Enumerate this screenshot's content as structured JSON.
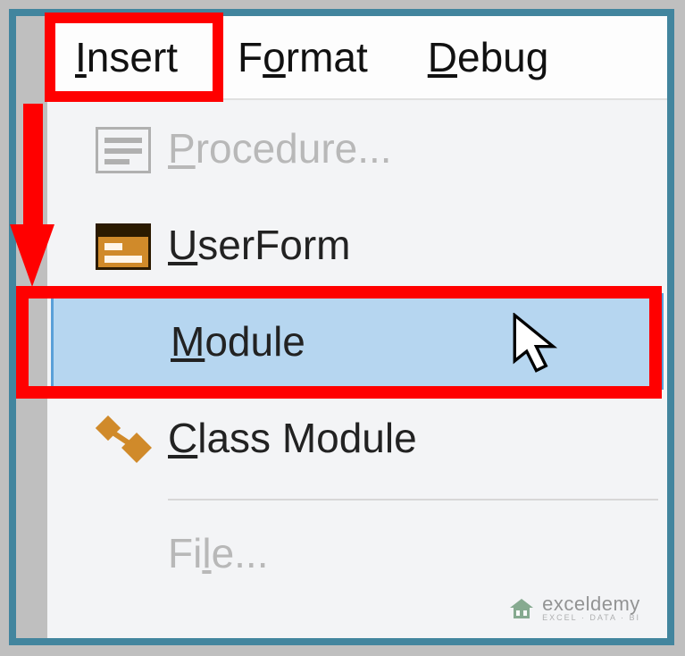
{
  "menubar": {
    "items": [
      {
        "pre": "",
        "ul": "I",
        "post": "nsert"
      },
      {
        "pre": "F",
        "ul": "o",
        "post": "rmat"
      },
      {
        "pre": "",
        "ul": "D",
        "post": "ebug"
      }
    ]
  },
  "dropdown": {
    "items": [
      {
        "pre": "",
        "ul": "P",
        "post": "rocedure...",
        "disabled": true
      },
      {
        "pre": "",
        "ul": "U",
        "post": "serForm",
        "disabled": false
      },
      {
        "pre": "",
        "ul": "M",
        "post": "odule",
        "disabled": false,
        "highlight": true
      },
      {
        "pre": "",
        "ul": "C",
        "post": "lass Module",
        "disabled": false
      },
      {
        "pre": "Fi",
        "ul": "l",
        "post": "e...",
        "disabled": true
      }
    ]
  },
  "annotations": {
    "highlight_color": "#ff0000",
    "arrow_color": "#ff0000"
  },
  "watermark": {
    "name": "exceldemy",
    "tagline": "EXCEL · DATA · BI"
  }
}
